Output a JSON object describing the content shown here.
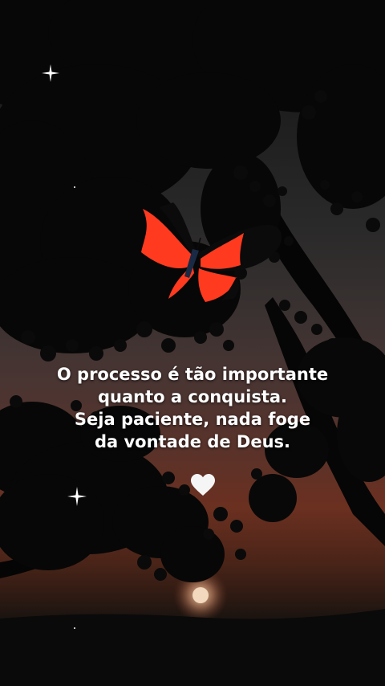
{
  "quote": {
    "lines": [
      "O processo é tão importante",
      "quanto a conquista.",
      "Seja paciente, nada foge",
      "da vontade de Deus."
    ]
  },
  "icons": {
    "heart": "white-heart-icon",
    "sparkle": "sparkle-icon",
    "butterfly": "red-butterfly"
  },
  "colors": {
    "butterfly_red": "#ff3a1f",
    "butterfly_black": "#0b0b0b",
    "sunset_glow": "#7a3420",
    "text": "#ffffff"
  }
}
